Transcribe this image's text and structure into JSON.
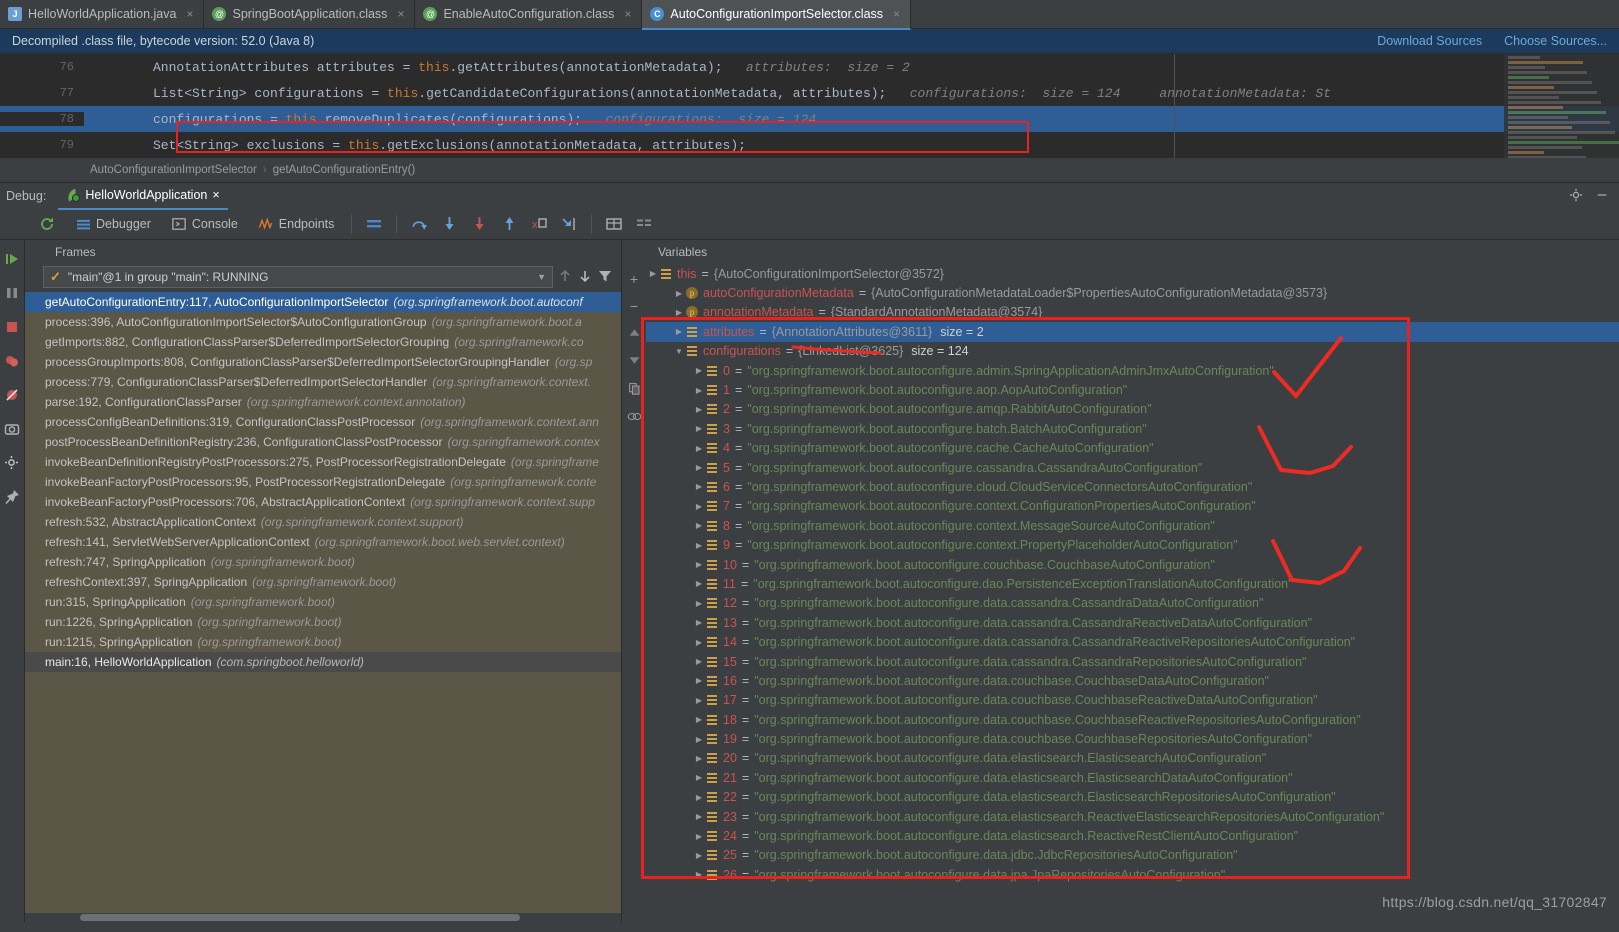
{
  "tabs": [
    {
      "label": "HelloWorldApplication.java",
      "icon": "java-file-icon",
      "active": false
    },
    {
      "label": "SpringBootApplication.class",
      "icon": "class-file-icon",
      "active": false
    },
    {
      "label": "EnableAutoConfiguration.class",
      "icon": "class-file-icon",
      "active": false
    },
    {
      "label": "AutoConfigurationImportSelector.class",
      "icon": "class-file-icon",
      "active": true
    }
  ],
  "notice": {
    "message": "Decompiled .class file, bytecode version: 52.0 (Java 8)",
    "download_sources": "Download Sources",
    "choose_sources": "Choose Sources..."
  },
  "editor": {
    "lines": [
      {
        "num": "76",
        "text": "AnnotationAttributes attributes = this.getAttributes(annotationMetadata);",
        "hint": "attributes:  size = 2",
        "highlighted": false,
        "boxed": false
      },
      {
        "num": "77",
        "text": "List<String> configurations = this.getCandidateConfigurations(annotationMetadata, attributes);",
        "hint": "configurations:  size = 124     annotationMetadata: St",
        "highlighted": false,
        "boxed": true
      },
      {
        "num": "78",
        "text": "configurations = this.removeDuplicates(configurations);",
        "hint": "configurations:  size = 124",
        "highlighted": true,
        "boxed": false
      },
      {
        "num": "79",
        "text": "Set<String> exclusions = this.getExclusions(annotationMetadata, attributes);",
        "hint": "",
        "highlighted": false,
        "boxed": false
      }
    ],
    "keyword": "this"
  },
  "breadcrumb": {
    "class": "AutoConfigurationImportSelector",
    "separator": "›",
    "method": "getAutoConfigurationEntry()"
  },
  "debug_header": {
    "label": "Debug:",
    "run_config": "HelloWorldApplication",
    "close": "×",
    "settings_icon": "gear-icon",
    "minimize_icon": "minimize-icon"
  },
  "debug_toolbar": {
    "items": [
      {
        "label": "Debugger",
        "icon": "debugger-icon"
      },
      {
        "label": "Console",
        "icon": "console-icon"
      },
      {
        "label": "Endpoints",
        "icon": "endpoints-icon"
      }
    ],
    "actions": [
      "layout-icon",
      "step-over-icon",
      "step-into-icon",
      "force-step-into-icon",
      "step-out-icon",
      "drop-frame-icon",
      "run-to-cursor-icon",
      "evaluate-icon",
      "mute-breakpoints-icon"
    ],
    "rerun_icon": "rerun-icon"
  },
  "left_rail": {
    "buttons": [
      "resume-program-icon",
      "pause-program-icon",
      "stop-icon",
      "view-breakpoints-icon",
      "mute-breakpoints-icon",
      "camera-icon",
      "settings-icon",
      "pin-tab-icon"
    ]
  },
  "frames": {
    "title": "Frames",
    "thread": "\"main\"@1 in group \"main\": RUNNING",
    "thread_state_icon": "check-icon",
    "nav_icons": [
      "arrow-up-icon",
      "arrow-down-icon",
      "filter-icon"
    ],
    "rows": [
      {
        "method": "getAutoConfigurationEntry:117, AutoConfigurationImportSelector",
        "pkg": "(org.springframework.boot.autoconf",
        "selected": true
      },
      {
        "method": "process:396, AutoConfigurationImportSelector$AutoConfigurationGroup",
        "pkg": "(org.springframework.boot.a",
        "selected": false
      },
      {
        "method": "getImports:882, ConfigurationClassParser$DeferredImportSelectorGrouping",
        "pkg": "(org.springframework.co",
        "selected": false
      },
      {
        "method": "processGroupImports:808, ConfigurationClassParser$DeferredImportSelectorGroupingHandler",
        "pkg": "(org.sp",
        "selected": false
      },
      {
        "method": "process:779, ConfigurationClassParser$DeferredImportSelectorHandler",
        "pkg": "(org.springframework.context.",
        "selected": false
      },
      {
        "method": "parse:192, ConfigurationClassParser",
        "pkg": "(org.springframework.context.annotation)",
        "selected": false
      },
      {
        "method": "processConfigBeanDefinitions:319, ConfigurationClassPostProcessor",
        "pkg": "(org.springframework.context.ann",
        "selected": false
      },
      {
        "method": "postProcessBeanDefinitionRegistry:236, ConfigurationClassPostProcessor",
        "pkg": "(org.springframework.contex",
        "selected": false
      },
      {
        "method": "invokeBeanDefinitionRegistryPostProcessors:275, PostProcessorRegistrationDelegate",
        "pkg": "(org.springframe",
        "selected": false
      },
      {
        "method": "invokeBeanFactoryPostProcessors:95, PostProcessorRegistrationDelegate",
        "pkg": "(org.springframework.conte",
        "selected": false
      },
      {
        "method": "invokeBeanFactoryPostProcessors:706, AbstractApplicationContext",
        "pkg": "(org.springframework.context.supp",
        "selected": false
      },
      {
        "method": "refresh:532, AbstractApplicationContext",
        "pkg": "(org.springframework.context.support)",
        "selected": false
      },
      {
        "method": "refresh:141, ServletWebServerApplicationContext",
        "pkg": "(org.springframework.boot.web.servlet.context)",
        "selected": false
      },
      {
        "method": "refresh:747, SpringApplication",
        "pkg": "(org.springframework.boot)",
        "selected": false
      },
      {
        "method": "refreshContext:397, SpringApplication",
        "pkg": "(org.springframework.boot)",
        "selected": false
      },
      {
        "method": "run:315, SpringApplication",
        "pkg": "(org.springframework.boot)",
        "selected": false
      },
      {
        "method": "run:1226, SpringApplication",
        "pkg": "(org.springframework.boot)",
        "selected": false
      },
      {
        "method": "run:1215, SpringApplication",
        "pkg": "(org.springframework.boot)",
        "selected": false
      },
      {
        "method": "main:16, HelloWorldApplication",
        "pkg": "(com.springboot.helloworld)",
        "selected": false,
        "lastsel": true
      }
    ]
  },
  "vars_rail": {
    "buttons": [
      "add-watch-icon",
      "remove-watch-icon",
      "move-up-icon",
      "move-down-icon",
      "copy-icon",
      "inspect-icon"
    ],
    "add_label": "+",
    "remove_label": "−"
  },
  "variables": {
    "title": "Variables",
    "rows": [
      {
        "indent": 0,
        "icon": "list-icon",
        "name": "this",
        "value": "{AutoConfigurationImportSelector@3572}",
        "size": "",
        "selected": false,
        "expanded": false
      },
      {
        "indent": 1,
        "icon": "field-icon",
        "name": "autoConfigurationMetadata",
        "value": "{AutoConfigurationMetadataLoader$PropertiesAutoConfigurationMetadata@3573}",
        "size": "",
        "selected": false,
        "expanded": false
      },
      {
        "indent": 1,
        "icon": "field-icon",
        "name": "annotationMetadata",
        "value": "{StandardAnnotationMetadata@3574}",
        "size": "",
        "selected": false,
        "expanded": false
      },
      {
        "indent": 1,
        "icon": "list-icon",
        "name": "attributes",
        "value": "{AnnotationAttributes@3611}",
        "size": "size = 2",
        "selected": true,
        "expanded": false
      },
      {
        "indent": 1,
        "icon": "list-icon",
        "name": "configurations",
        "value": "{LinkedList@3625}",
        "size": "size = 124",
        "selected": false,
        "expanded": true
      }
    ],
    "list_name": "configurations",
    "list_type": "{LinkedList@3625}",
    "list_size": "size = 124",
    "items": [
      {
        "index": "0",
        "value": "\"org.springframework.boot.autoconfigure.admin.SpringApplicationAdminJmxAutoConfiguration\""
      },
      {
        "index": "1",
        "value": "\"org.springframework.boot.autoconfigure.aop.AopAutoConfiguration\""
      },
      {
        "index": "2",
        "value": "\"org.springframework.boot.autoconfigure.amqp.RabbitAutoConfiguration\""
      },
      {
        "index": "3",
        "value": "\"org.springframework.boot.autoconfigure.batch.BatchAutoConfiguration\""
      },
      {
        "index": "4",
        "value": "\"org.springframework.boot.autoconfigure.cache.CacheAutoConfiguration\""
      },
      {
        "index": "5",
        "value": "\"org.springframework.boot.autoconfigure.cassandra.CassandraAutoConfiguration\""
      },
      {
        "index": "6",
        "value": "\"org.springframework.boot.autoconfigure.cloud.CloudServiceConnectorsAutoConfiguration\""
      },
      {
        "index": "7",
        "value": "\"org.springframework.boot.autoconfigure.context.ConfigurationPropertiesAutoConfiguration\""
      },
      {
        "index": "8",
        "value": "\"org.springframework.boot.autoconfigure.context.MessageSourceAutoConfiguration\""
      },
      {
        "index": "9",
        "value": "\"org.springframework.boot.autoconfigure.context.PropertyPlaceholderAutoConfiguration\""
      },
      {
        "index": "10",
        "value": "\"org.springframework.boot.autoconfigure.couchbase.CouchbaseAutoConfiguration\""
      },
      {
        "index": "11",
        "value": "\"org.springframework.boot.autoconfigure.dao.PersistenceExceptionTranslationAutoConfiguration\""
      },
      {
        "index": "12",
        "value": "\"org.springframework.boot.autoconfigure.data.cassandra.CassandraDataAutoConfiguration\""
      },
      {
        "index": "13",
        "value": "\"org.springframework.boot.autoconfigure.data.cassandra.CassandraReactiveDataAutoConfiguration\""
      },
      {
        "index": "14",
        "value": "\"org.springframework.boot.autoconfigure.data.cassandra.CassandraReactiveRepositoriesAutoConfiguration\""
      },
      {
        "index": "15",
        "value": "\"org.springframework.boot.autoconfigure.data.cassandra.CassandraRepositoriesAutoConfiguration\""
      },
      {
        "index": "16",
        "value": "\"org.springframework.boot.autoconfigure.data.couchbase.CouchbaseDataAutoConfiguration\""
      },
      {
        "index": "17",
        "value": "\"org.springframework.boot.autoconfigure.data.couchbase.CouchbaseReactiveDataAutoConfiguration\""
      },
      {
        "index": "18",
        "value": "\"org.springframework.boot.autoconfigure.data.couchbase.CouchbaseReactiveRepositoriesAutoConfiguration\""
      },
      {
        "index": "19",
        "value": "\"org.springframework.boot.autoconfigure.data.couchbase.CouchbaseRepositoriesAutoConfiguration\""
      },
      {
        "index": "20",
        "value": "\"org.springframework.boot.autoconfigure.data.elasticsearch.ElasticsearchAutoConfiguration\""
      },
      {
        "index": "21",
        "value": "\"org.springframework.boot.autoconfigure.data.elasticsearch.ElasticsearchDataAutoConfiguration\""
      },
      {
        "index": "22",
        "value": "\"org.springframework.boot.autoconfigure.data.elasticsearch.ElasticsearchRepositoriesAutoConfiguration\""
      },
      {
        "index": "23",
        "value": "\"org.springframework.boot.autoconfigure.data.elasticsearch.ReactiveElasticsearchRepositoriesAutoConfiguration\""
      },
      {
        "index": "24",
        "value": "\"org.springframework.boot.autoconfigure.data.elasticsearch.ReactiveRestClientAutoConfiguration\""
      },
      {
        "index": "25",
        "value": "\"org.springframework.boot.autoconfigure.data.jdbc.JdbcRepositoriesAutoConfiguration\""
      },
      {
        "index": "26",
        "value": "\"org.springframework.boot.autoconfigure.data.jpa.JpaRepositoriesAutoConfiguration\""
      }
    ]
  },
  "watermark": "https://blog.csdn.net/qq_31702847",
  "colors": {
    "accent": "#4a88c7",
    "selection": "#2f5d96",
    "annotation_red": "#e8231f",
    "string_green": "#6a8759",
    "name_red": "#c75450",
    "keyword_orange": "#cc7832",
    "frames_bg": "#5c5647"
  }
}
